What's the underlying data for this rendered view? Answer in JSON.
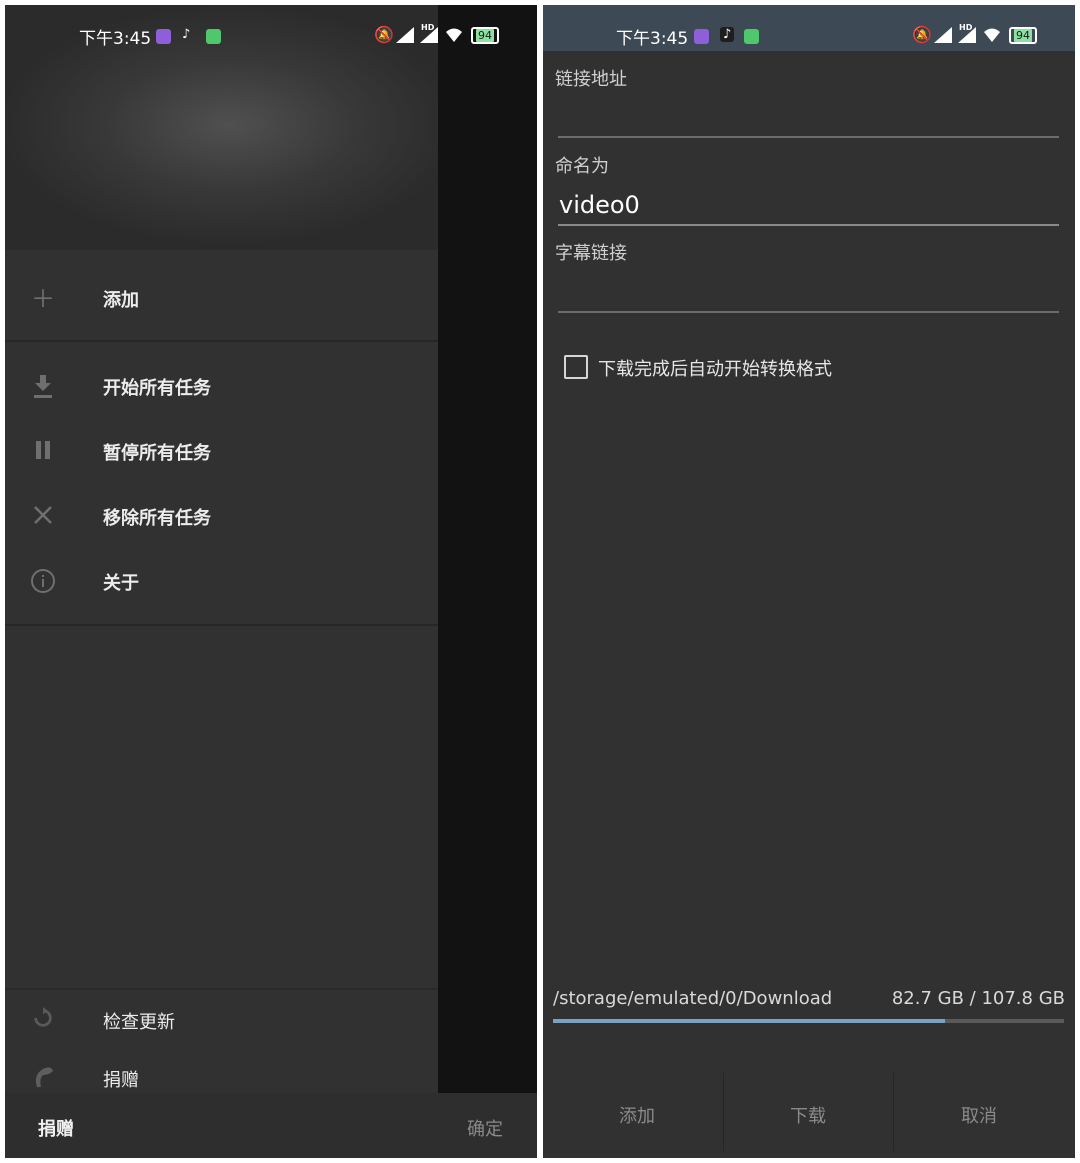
{
  "left_screen": {
    "status_bar": {
      "time": "下午3:45",
      "battery": "94",
      "network_badge": "HD"
    },
    "drawer": {
      "items": [
        {
          "icon": "plus-icon",
          "label": "添加"
        },
        {
          "icon": "download-icon",
          "label": "开始所有任务"
        },
        {
          "icon": "pause-icon",
          "label": "暂停所有任务"
        },
        {
          "icon": "close-icon",
          "label": "移除所有任务"
        },
        {
          "icon": "info-icon",
          "label": "关于"
        },
        {
          "icon": "refresh-icon",
          "label": "检查更新"
        },
        {
          "icon": "donate-icon",
          "label": "捐赠"
        }
      ]
    },
    "bottom_bar": {
      "donate_label": "捐赠",
      "confirm_label": "确定"
    }
  },
  "right_screen": {
    "status_bar": {
      "time": "下午3:45",
      "battery": "94",
      "network_badge": "HD"
    },
    "form": {
      "url_label": "链接地址",
      "url_value": "",
      "name_label": "命名为",
      "name_value": "video0",
      "subtitle_label": "字幕链接",
      "subtitle_value": "",
      "auto_convert_label": "下载完成后自动开始转换格式",
      "auto_convert_checked": false
    },
    "storage": {
      "path": "/storage/emulated/0/Download",
      "usage": "82.7 GB / 107.8 GB",
      "used_fraction": 0.767
    },
    "buttons": {
      "add": "添加",
      "download": "下载",
      "cancel": "取消"
    }
  },
  "colors": {
    "background": "#313131",
    "scrim": "#121212",
    "storage_fill": "#7aa3c3",
    "icon_gray": "#6f6f6f"
  }
}
